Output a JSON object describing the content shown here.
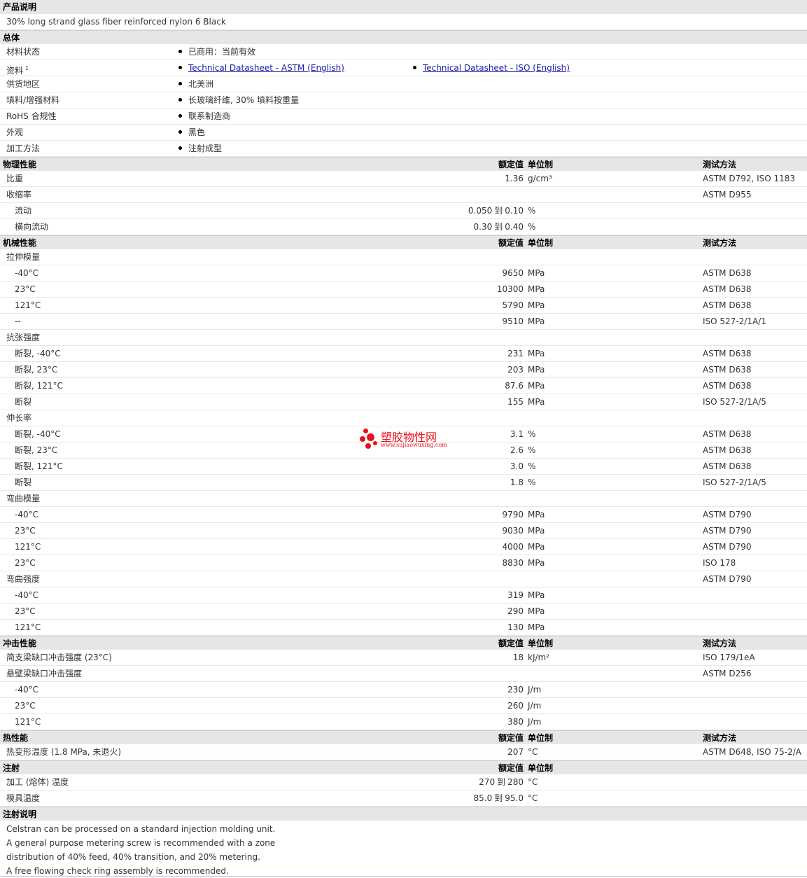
{
  "product_desc": {
    "title": "产品说明",
    "text": "30% long strand glass fiber reinforced nylon 6 Black"
  },
  "general": {
    "title": "总体",
    "rows": [
      {
        "label": "材料状态",
        "value": "已商用：当前有效"
      },
      {
        "label": "资料",
        "sup": "1",
        "link1": "Technical Datasheet - ASTM (English)",
        "link2": "Technical Datasheet - ISO (English)"
      },
      {
        "label": "供货地区",
        "value": "北美洲"
      },
      {
        "label": "填料/增强材料",
        "value": "长玻璃纤维, 30% 填料按重量"
      },
      {
        "label": "RoHS 合规性",
        "value": "联系制造商"
      },
      {
        "label": "外观",
        "value": "黑色"
      },
      {
        "label": "加工方法",
        "value": "注射成型"
      }
    ]
  },
  "headers": {
    "value": "额定值",
    "unit": "单位制",
    "test": "测试方法"
  },
  "to_word": "到",
  "physical": {
    "title": "物理性能",
    "rows": [
      {
        "label": "比重",
        "value": "1.36",
        "unit": "g/cm³",
        "test": "ASTM D792, ISO 1183"
      },
      {
        "label": "收缩率",
        "test": "ASTM D955"
      },
      {
        "label": "流动",
        "v1": "0.050",
        "v2": "0.10",
        "unit": "%"
      },
      {
        "label": "横向流动",
        "v1": "0.30",
        "v2": "0.40",
        "unit": "%"
      }
    ]
  },
  "mechanical": {
    "title": "机械性能",
    "rows": [
      {
        "label": "拉伸模量"
      },
      {
        "label": "-40°C",
        "value": "9650",
        "unit": "MPa",
        "test": "ASTM D638"
      },
      {
        "label": "23°C",
        "value": "10300",
        "unit": "MPa",
        "test": "ASTM D638"
      },
      {
        "label": "121°C",
        "value": "5790",
        "unit": "MPa",
        "test": "ASTM D638"
      },
      {
        "label": "--",
        "value": "9510",
        "unit": "MPa",
        "test": "ISO 527-2/1A/1"
      },
      {
        "label": "抗张强度"
      },
      {
        "label": "断裂, -40°C",
        "value": "231",
        "unit": "MPa",
        "test": "ASTM D638"
      },
      {
        "label": "断裂, 23°C",
        "value": "203",
        "unit": "MPa",
        "test": "ASTM D638"
      },
      {
        "label": "断裂, 121°C",
        "value": "87.6",
        "unit": "MPa",
        "test": "ASTM D638"
      },
      {
        "label": "断裂",
        "value": "155",
        "unit": "MPa",
        "test": "ISO 527-2/1A/5"
      },
      {
        "label": "伸长率"
      },
      {
        "label": "断裂, -40°C",
        "value": "3.1",
        "unit": "%",
        "test": "ASTM D638"
      },
      {
        "label": "断裂, 23°C",
        "value": "2.6",
        "unit": "%",
        "test": "ASTM D638"
      },
      {
        "label": "断裂, 121°C",
        "value": "3.0",
        "unit": "%",
        "test": "ASTM D638"
      },
      {
        "label": "断裂",
        "value": "1.8",
        "unit": "%",
        "test": "ISO 527-2/1A/5"
      },
      {
        "label": "弯曲模量"
      },
      {
        "label": "-40°C",
        "value": "9790",
        "unit": "MPa",
        "test": "ASTM D790"
      },
      {
        "label": "23°C",
        "value": "9030",
        "unit": "MPa",
        "test": "ASTM D790"
      },
      {
        "label": "121°C",
        "value": "4000",
        "unit": "MPa",
        "test": "ASTM D790"
      },
      {
        "label": "23°C",
        "value": "8830",
        "unit": "MPa",
        "test": "ISO 178"
      },
      {
        "label": "弯曲强度",
        "test": "ASTM D790"
      },
      {
        "label": "-40°C",
        "value": "319",
        "unit": "MPa"
      },
      {
        "label": "23°C",
        "value": "290",
        "unit": "MPa"
      },
      {
        "label": "121°C",
        "value": "130",
        "unit": "MPa"
      }
    ]
  },
  "impact": {
    "title": "冲击性能",
    "rows": [
      {
        "label": "简支梁缺口冲击强度 (23°C)",
        "value": "18",
        "unit": "kJ/m²",
        "test": "ISO 179/1eA"
      },
      {
        "label": "悬壁梁缺口冲击强度",
        "test": "ASTM D256"
      },
      {
        "label": "-40°C",
        "value": "230",
        "unit": "J/m"
      },
      {
        "label": "23°C",
        "value": "260",
        "unit": "J/m"
      },
      {
        "label": "121°C",
        "value": "380",
        "unit": "J/m"
      }
    ]
  },
  "thermal": {
    "title": "热性能",
    "rows": [
      {
        "label": "热变形温度 (1.8 MPa, 未退火)",
        "value": "207",
        "unit": "°C",
        "test": "ASTM D648, ISO 75-2/A"
      }
    ]
  },
  "injection": {
    "title": "注射",
    "rows": [
      {
        "label": "加工 (熔体) 温度",
        "v1": "270",
        "v2": "280",
        "unit": "°C"
      },
      {
        "label": "模具温度",
        "v1": "85.0",
        "v2": "95.0",
        "unit": "°C"
      }
    ]
  },
  "injection_notes": {
    "title": "注射说明",
    "lines": [
      "Celstran can be processed on a standard injection molding unit.",
      "A general purpose metering screw is recommended with a zone",
      "distribution of 40% feed, 40% transition, and 20% metering.",
      "A free flowing check ring assembly is recommended."
    ]
  },
  "watermark": {
    "title": "塑胶物性网",
    "url": "www.sujiaowuxing.com",
    "color": "#e8101a"
  }
}
